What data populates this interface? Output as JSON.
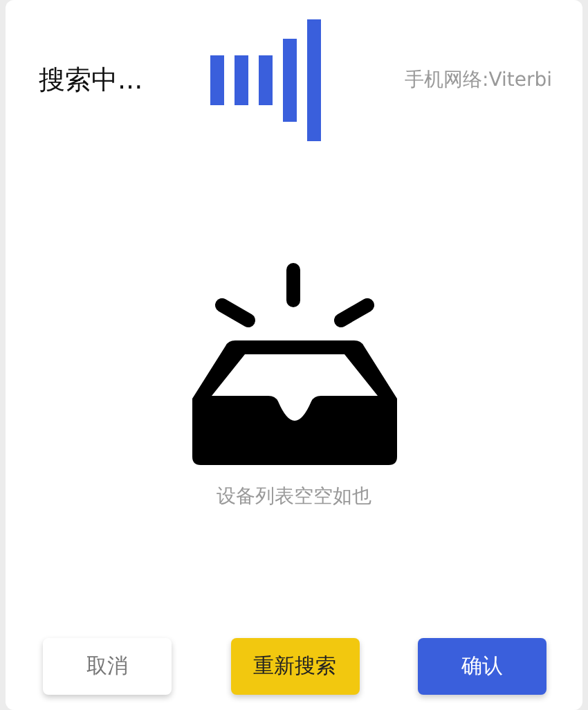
{
  "header": {
    "title": "搜索中...",
    "network": "手机网络:Viterbi"
  },
  "empty_state": {
    "message": "设备列表空空如也"
  },
  "buttons": [
    {
      "label": "取消",
      "kind": "cancel"
    },
    {
      "label": "重新搜索",
      "kind": "retry"
    },
    {
      "label": "确认",
      "kind": "confirm"
    }
  ]
}
